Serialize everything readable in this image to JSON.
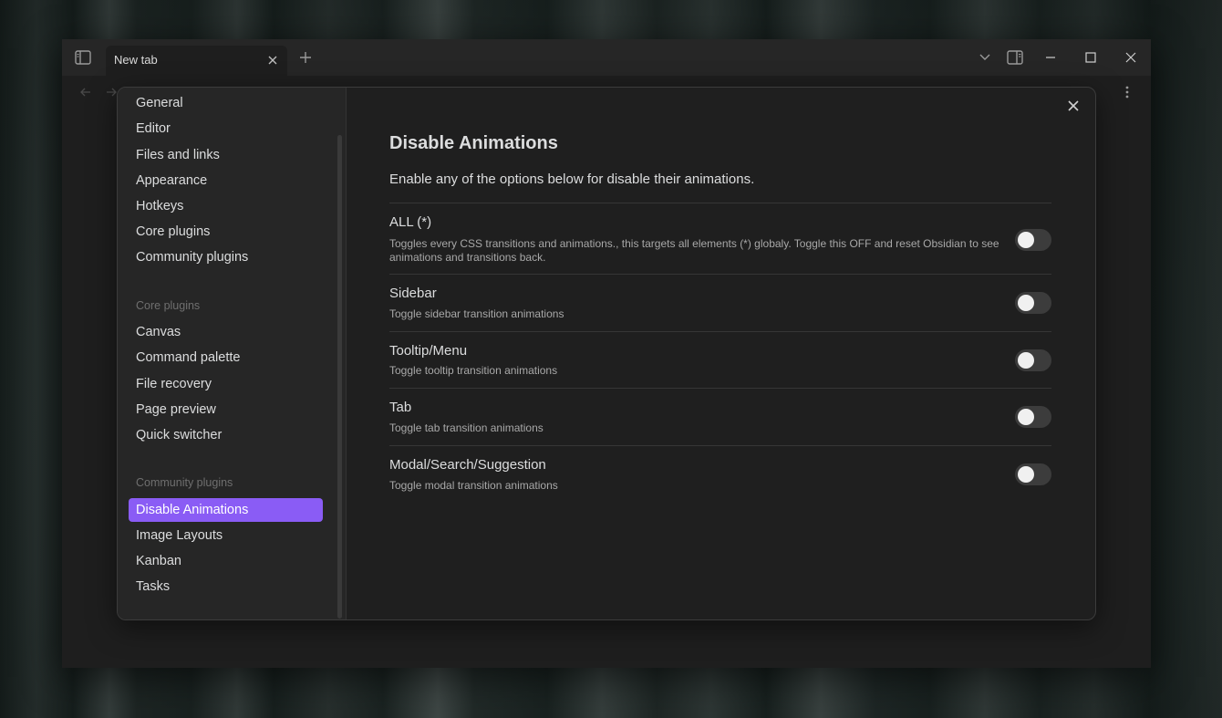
{
  "tab": {
    "title": "New tab"
  },
  "sidebar": {
    "options": [
      {
        "label": "General"
      },
      {
        "label": "Editor"
      },
      {
        "label": "Files and links"
      },
      {
        "label": "Appearance"
      },
      {
        "label": "Hotkeys"
      },
      {
        "label": "Core plugins"
      },
      {
        "label": "Community plugins"
      }
    ],
    "core_heading": "Core plugins",
    "core_plugins": [
      {
        "label": "Canvas"
      },
      {
        "label": "Command palette"
      },
      {
        "label": "File recovery"
      },
      {
        "label": "Page preview"
      },
      {
        "label": "Quick switcher"
      }
    ],
    "community_heading": "Community plugins",
    "community_plugins": [
      {
        "label": "Disable Animations",
        "active": true
      },
      {
        "label": "Image Layouts"
      },
      {
        "label": "Kanban"
      },
      {
        "label": "Tasks"
      }
    ]
  },
  "content": {
    "title": "Disable Animations",
    "intro": "Enable any of the options below for disable their animations.",
    "settings": [
      {
        "name": "ALL (*)",
        "desc": "Toggles every CSS transitions and animations., this targets all elements (*) globaly. Toggle this OFF and reset Obsidian to see animations and transitions back.",
        "enabled": false
      },
      {
        "name": "Sidebar",
        "desc": "Toggle sidebar transition animations",
        "enabled": false
      },
      {
        "name": "Tooltip/Menu",
        "desc": "Toggle tooltip transition animations",
        "enabled": false
      },
      {
        "name": "Tab",
        "desc": "Toggle tab transition animations",
        "enabled": false
      },
      {
        "name": "Modal/Search/Suggestion",
        "desc": "Toggle modal transition animations",
        "enabled": false
      }
    ]
  },
  "colors": {
    "accent": "#8a5cf5"
  }
}
